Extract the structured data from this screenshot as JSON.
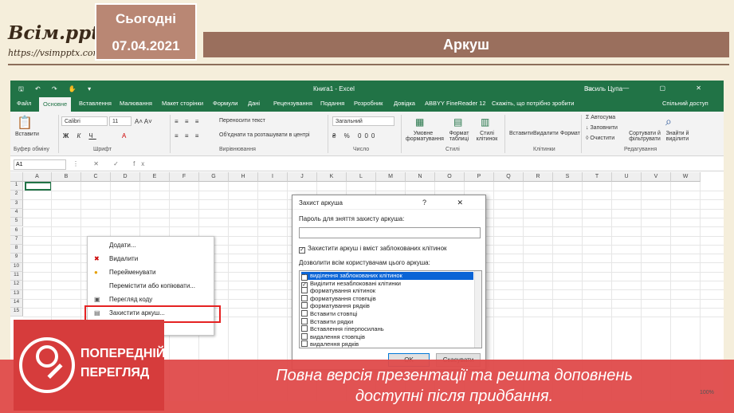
{
  "slide": {
    "logo_main": "Всім.pptx",
    "logo_sub": "https://vsimpptx.com",
    "today_label": "Сьогодні",
    "date": "07.04.2021",
    "title": "Аркуш"
  },
  "excel": {
    "qat": "🖫 ↶ ↷ ✋ ▾",
    "window_title": "Книга1 - Excel",
    "user": "Василь Цупа",
    "window_controls": "▭ — ▢ ✕",
    "tabs": [
      "Файл",
      "Основне",
      "Вставлення",
      "Малювання",
      "Макет сторінки",
      "Формули",
      "Дані",
      "Рецензування",
      "Подання",
      "Розробник",
      "Довідка",
      "ABBYY FineReader 12",
      "Скажіть, що потрібно зробити",
      "Спільний доступ"
    ],
    "ribbon": {
      "paste": "Вставити",
      "clipboard_group": "Буфер обміну",
      "font_name": "Calibri",
      "font_size": "11",
      "font_group": "Шрифт",
      "wrap_text": "Переносити текст",
      "merge_center": "Об'єднати та розташувати в центрі",
      "alignment_group": "Вирівнювання",
      "number_format": "Загальний",
      "number_group": "Число",
      "cond_format": "Умовне форматування",
      "format_table": "Формат таблиці",
      "cell_styles": "Стилі клітинок",
      "styles_group": "Стилі",
      "insert": "Вставити",
      "delete": "Видалити",
      "format": "Формат",
      "cells_group": "Клітинки",
      "autosum": "Автосума",
      "fill": "Заповнити",
      "clear": "Очистити",
      "sort_filter": "Сортувати й фільтрувати",
      "find_select": "Знайти й виділити",
      "editing_group": "Редагування"
    },
    "name_box": "A1",
    "fx_icons": "⋮ ✕ ✓ fx",
    "columns": [
      "A",
      "B",
      "C",
      "D",
      "E",
      "F",
      "G",
      "H",
      "I",
      "J",
      "K",
      "L",
      "M",
      "N",
      "O",
      "P",
      "Q",
      "R",
      "S",
      "T",
      "U",
      "V",
      "W"
    ],
    "rows": [
      "1",
      "2",
      "3",
      "4",
      "5",
      "6",
      "7",
      "8",
      "9",
      "10",
      "11",
      "12",
      "13",
      "14",
      "15"
    ],
    "context_menu": [
      {
        "label": "Додати...",
        "icon": ""
      },
      {
        "label": "Видалити",
        "icon": "✖"
      },
      {
        "label": "Перейменувати",
        "icon": "●"
      },
      {
        "label": "Перемістити або копіювати...",
        "icon": ""
      },
      {
        "label": "Перегляд коду",
        "icon": "▣"
      },
      {
        "label": "Захистити аркуш...",
        "icon": "▤"
      }
    ],
    "dialog": {
      "title": "Захист аркуша",
      "controls": "? ✕",
      "password_label": "Пароль для зняття захисту аркуша:",
      "protect_check": "Захистити аркуш і вміст заблокованих клітинок",
      "allow_label": "Дозволити всім користувачам цього аркуша:",
      "options": [
        {
          "label": "виділення заблокованих клітинок",
          "checked": true
        },
        {
          "label": "Виділити незаблоковані клітинки",
          "checked": true
        },
        {
          "label": "форматування клітинок",
          "checked": false
        },
        {
          "label": "форматування стовпців",
          "checked": false
        },
        {
          "label": "форматування рядків",
          "checked": false
        },
        {
          "label": "Вставити стовпці",
          "checked": false
        },
        {
          "label": "Вставити рядки",
          "checked": false
        },
        {
          "label": "Вставлення гіперпосилань",
          "checked": false
        },
        {
          "label": "видалення стовпців",
          "checked": false
        },
        {
          "label": "видалення рядків",
          "checked": false
        }
      ],
      "ok": "OK",
      "cancel": "Скасувати"
    },
    "zoom": "100%"
  },
  "promo": {
    "line1": "ПОПЕРЕДНІЙ",
    "line2": "ПЕРЕГЛЯД",
    "banner1": "Повна версія презентації та решта доповнень",
    "banner2": "доступні після придбання."
  }
}
